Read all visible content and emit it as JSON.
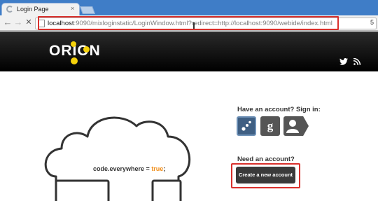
{
  "browser": {
    "tab_title": "Login Page",
    "tab_close": "×",
    "back_glyph": "←",
    "forward_glyph": "→",
    "stop_glyph": "✕",
    "url_host": "localhost",
    "url_rest": ":9090/mixloginstatic/LoginWindow.html?redirect=http://localhost:9090/webide/index.html",
    "omnibox_end": "5"
  },
  "site": {
    "logo_text": "ORION",
    "header_icons": [
      "twitter-icon",
      "rss-icon"
    ]
  },
  "content": {
    "code_prefix": "code.everywhere = ",
    "code_keyword": "true",
    "code_suffix": ";",
    "signin_title": "Have an account? Sign in:",
    "signin_options": [
      "orion-account",
      "google",
      "guest"
    ],
    "need_account_title": "Need an account?",
    "create_account_label": "Create a new account"
  },
  "colors": {
    "highlight": "#d9302c",
    "logo_dot": "#f5d10a",
    "code_keyword": "#f08e19"
  }
}
